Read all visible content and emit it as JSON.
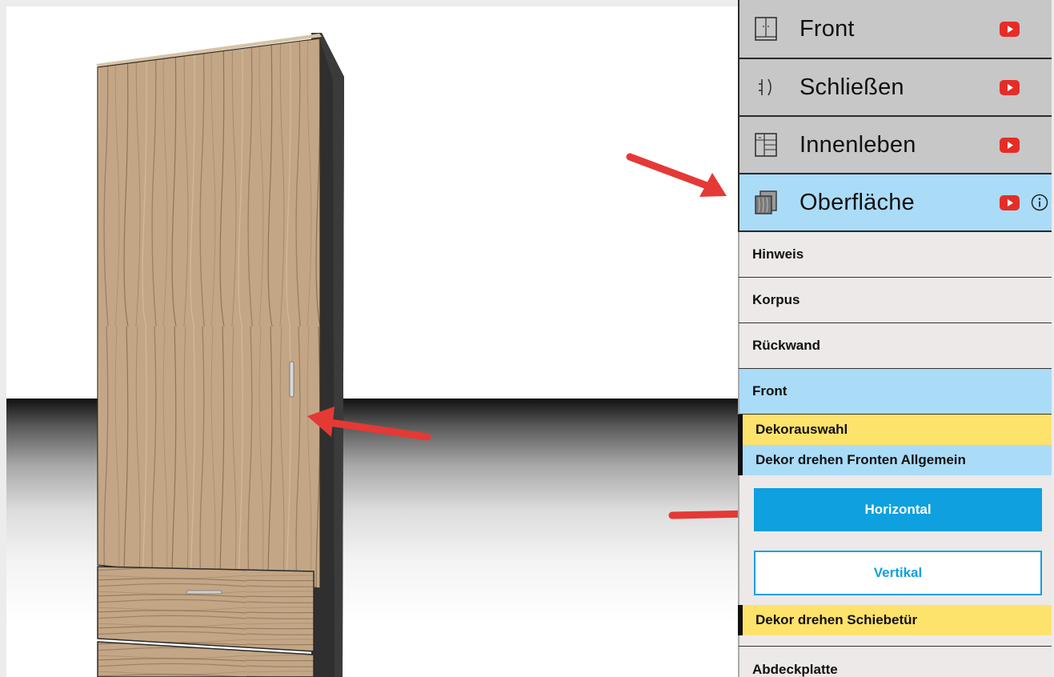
{
  "menu": {
    "main_items": [
      {
        "label": "Front",
        "icon": "front-icon",
        "video": "youtube-icon"
      },
      {
        "label": "Schließen",
        "icon": "close-handle-icon",
        "video": "youtube-icon"
      },
      {
        "label": "Innenleben",
        "icon": "interior-icon",
        "video": "youtube-icon"
      },
      {
        "label": "Oberfläche",
        "icon": "surface-icon",
        "video": "youtube-icon",
        "info": "info-icon",
        "active": true
      }
    ],
    "sub_items": [
      {
        "label": "Hinweis"
      },
      {
        "label": "Korpus"
      },
      {
        "label": "Rückwand"
      },
      {
        "label": "Front",
        "active": true
      }
    ],
    "front_sections": {
      "dekorauswahl": "Dekorauswahl",
      "dekor_drehen_allgemein": "Dekor drehen Fronten Allgemein",
      "dekor_drehen_schiebetuer": "Dekor drehen Schiebetür"
    },
    "rotation_options": {
      "horizontal": "Horizontal",
      "vertical": "Vertikal",
      "selected": "Horizontal"
    },
    "next_item": "Abdeckplatte"
  },
  "colors": {
    "active_blue": "#aadcf8",
    "button_blue": "#0ea0df",
    "highlight_yellow": "#fde36b",
    "arrow_red": "#e53935"
  }
}
